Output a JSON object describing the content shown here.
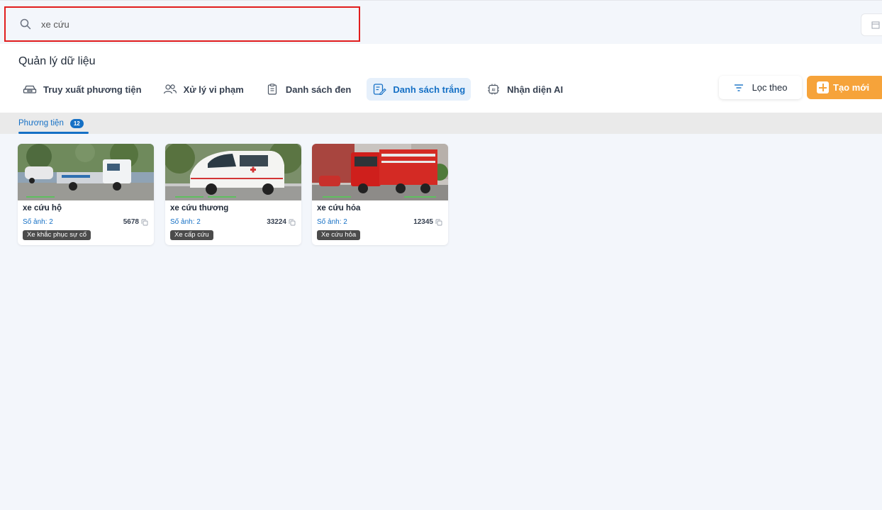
{
  "search": {
    "value": "xe cứu",
    "placeholder": ""
  },
  "page": {
    "title": "Quản lý dữ liệu"
  },
  "tabs": [
    {
      "label": "Truy xuất phương tiện",
      "icon": "car-icon",
      "active": false
    },
    {
      "label": "Xử lý vi phạm",
      "icon": "users-icon",
      "active": false
    },
    {
      "label": "Danh sách đen",
      "icon": "clipboard-icon",
      "active": false
    },
    {
      "label": "Danh sách trắng",
      "icon": "list-edit-icon",
      "active": true
    },
    {
      "label": "Nhận diện AI",
      "icon": "ai-chip-icon",
      "active": false
    }
  ],
  "actions": {
    "filter_label": "Lọc theo",
    "create_label": "Tạo mới"
  },
  "subtab": {
    "label": "Phương tiện",
    "count": "12"
  },
  "cards": [
    {
      "name": "xe cứu hộ",
      "images": "Số ảnh: 2",
      "number": "5678",
      "tag": "Xe khắc phục sự cố"
    },
    {
      "name": "xe cứu thương",
      "images": "Số ảnh: 2",
      "number": "33224",
      "tag": "Xe cấp cứu"
    },
    {
      "name": "xe cứu hỏa",
      "images": "Số ảnh: 2",
      "number": "12345",
      "tag": "Xe cứu hỏa"
    }
  ],
  "colors": {
    "accent": "#1570c5",
    "create": "#f6a33a",
    "highlight": "#e11d1d"
  }
}
